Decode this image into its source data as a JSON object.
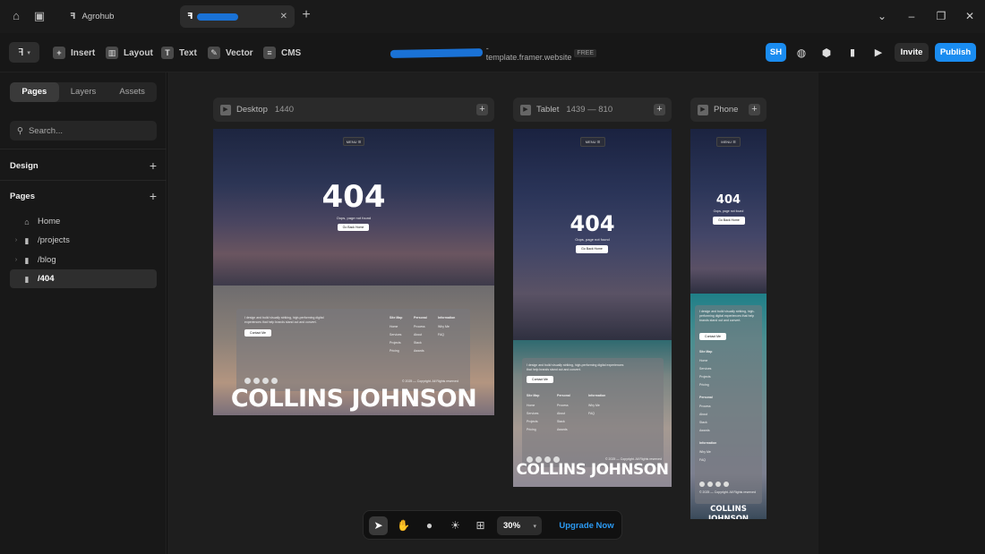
{
  "titlebar": {
    "tabs": [
      {
        "label": "Agrohub"
      },
      {
        "label": ""
      }
    ]
  },
  "toolbar": {
    "insert": "Insert",
    "layout": "Layout",
    "text": "Text",
    "vector": "Vector",
    "cms": "CMS",
    "url_suffix": "-template.framer.website",
    "free_badge": "FREE",
    "avatar": "SH",
    "invite": "Invite",
    "publish": "Publish"
  },
  "sidebar": {
    "tabs": [
      "Pages",
      "Layers",
      "Assets"
    ],
    "search_placeholder": "Search...",
    "design_heading": "Design",
    "pages_heading": "Pages",
    "pages": [
      {
        "label": "Home",
        "icon": "home-icon"
      },
      {
        "label": "/projects",
        "icon": "page-icon"
      },
      {
        "label": "/blog",
        "icon": "page-icon"
      },
      {
        "label": "/404",
        "icon": "page-icon"
      }
    ]
  },
  "frames": {
    "desktop": {
      "name": "Desktop",
      "dims": "1440"
    },
    "tablet": {
      "name": "Tablet",
      "dims": "1439 — 810"
    },
    "phone": {
      "name": "Phone",
      "dims": ""
    }
  },
  "site": {
    "menu": "MENU ☰",
    "code": "404",
    "message": "Oops, page not found",
    "button": "Go Back Home",
    "intro": "I design and build visually striking, high-performing digital experiences that help brands stand out and convert.",
    "contact": "Contact Me",
    "col_sitemap": "Site Map",
    "col_personal": "Personal",
    "col_info": "Information",
    "sitemap": [
      "Home",
      "Services",
      "Projects",
      "Pricing"
    ],
    "personal": [
      "Process",
      "About",
      "Stack",
      "Awards"
    ],
    "info": [
      "Why Me",
      "FAQ"
    ],
    "copyright": "© 2025 — Copyright. All Rights reserved",
    "name": "COLLINS JOHNSON"
  },
  "bottom": {
    "zoom": "30%",
    "upgrade": "Upgrade Now"
  }
}
